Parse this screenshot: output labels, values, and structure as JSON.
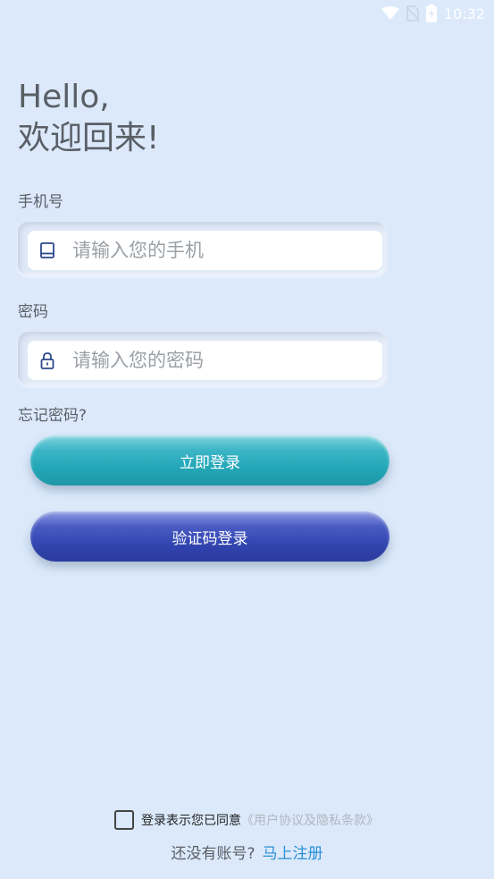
{
  "status_bar": {
    "time": "10:32",
    "icons": [
      "wifi-icon",
      "no-sim-icon",
      "battery-charging-icon"
    ]
  },
  "greeting": {
    "line1": "Hello,",
    "line2": "欢迎回来!"
  },
  "phone": {
    "label": "手机号",
    "placeholder": "请输入您的手机",
    "icon": "phone-icon"
  },
  "password": {
    "label": "密码",
    "placeholder": "请输入您的密码",
    "icon": "lock-icon"
  },
  "forgot_password": "忘记密码?",
  "buttons": {
    "login": "立即登录",
    "code_login": "验证码登录"
  },
  "colors": {
    "background": "#dbe9fb",
    "login_button": "#23a7b8",
    "code_button": "#3245b0",
    "link": "#2a8fd6"
  },
  "agreement": {
    "text": "登录表示您已同意",
    "link": "《用户协议及隐私条款》",
    "checked": false
  },
  "register": {
    "question": "还没有账号?",
    "link": "马上注册"
  }
}
